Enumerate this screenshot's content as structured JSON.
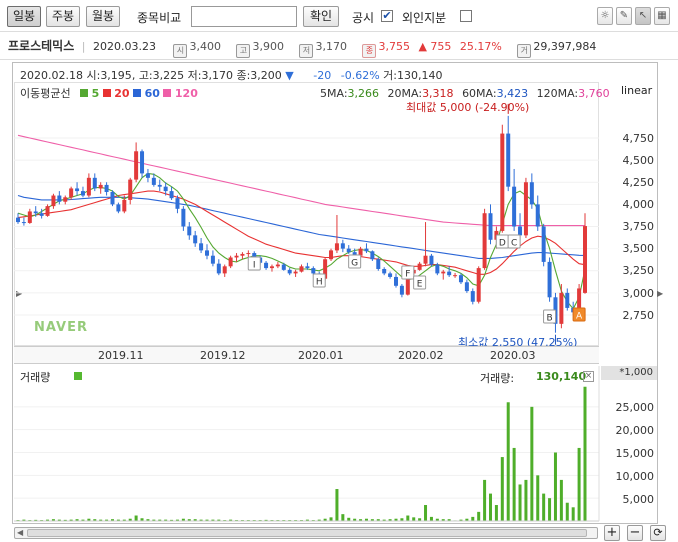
{
  "toolbar": {
    "tabs": [
      "일봉",
      "주봉",
      "월봉"
    ],
    "selected_tab": 0,
    "compare_label": "종목비교",
    "compare_placeholder": "",
    "confirm_label": "확인",
    "disclosure_label": "공시",
    "disclosure_checked": true,
    "foreign_label": "외인지분",
    "foreign_checked": false
  },
  "stock": {
    "name": "프로스테믹스",
    "date": "2020.03.23",
    "start_label": "시",
    "start": "3,400",
    "high_label": "고",
    "high": "3,900",
    "low_label": "저",
    "low": "3,170",
    "close_label": "종",
    "close": "3,755",
    "change": "▲ 755",
    "rate": "25.17%",
    "volume_label": "거",
    "volume": "29,397,984"
  },
  "hover": {
    "date": "2020.02.18",
    "open_label": "시:",
    "open": "3,195",
    "high_label": "고:",
    "high": "3,225",
    "low_label": "저:",
    "low": "3,170",
    "close_label": "종:",
    "close": "3,200",
    "dir": "▼",
    "change": "-20",
    "rate": "-0.62%",
    "vol_label": "거:",
    "vol": "130,140"
  },
  "scale_mode": "linear",
  "ma_legend": {
    "title": "이동평균선",
    "items": [
      {
        "n": "5",
        "color": "#55a832"
      },
      {
        "n": "20",
        "color": "#e83232"
      },
      {
        "n": "60",
        "color": "#2b66d6"
      },
      {
        "n": "120",
        "color": "#ef5fa8"
      }
    ]
  },
  "ma_values": [
    {
      "label": "5MA:",
      "value": "3,266",
      "color": "#3a8a1c"
    },
    {
      "label": "20MA:",
      "value": "3,318",
      "color": "#c81e1e"
    },
    {
      "label": "60MA:",
      "value": "3,423",
      "color": "#1e55c0"
    },
    {
      "label": "120MA:",
      "value": "3,760",
      "color": "#e0409a"
    }
  ],
  "max_label": "최대값 5,000 (-24.90%)",
  "min_label": "최소값 2,550 (47.25%)",
  "brand": "NAVER",
  "x_ticks": [
    "2019.11",
    "2019.12",
    "2020.01",
    "2020.02",
    "2020.03"
  ],
  "y_ticks": [
    "4,750",
    "4,500",
    "4,250",
    "4,000",
    "3,750",
    "3,500",
    "3,250",
    "3,000",
    "2,750"
  ],
  "markers": [
    "I",
    "H",
    "G",
    "F",
    "E",
    "D",
    "C",
    "B",
    "A"
  ],
  "volume": {
    "title": "거래량",
    "legend_color": "#55b830",
    "value_label": "거래량:",
    "value": "130,140",
    "unit": "*1,000",
    "y_ticks": [
      "25,000",
      "20,000",
      "15,000",
      "10,000",
      "5,000"
    ]
  },
  "colors": {
    "up": "#e23a3a",
    "down": "#2f6fd8",
    "vol": "#4fae2a"
  },
  "chart_data": {
    "type": "candlestick",
    "x_range": [
      "2019-10-17",
      "2020-03-23"
    ],
    "ylim": [
      2550,
      5050
    ],
    "candles_ohlc": [
      [
        3850,
        3900,
        3780,
        3800
      ],
      [
        3800,
        3850,
        3760,
        3790
      ],
      [
        3790,
        3950,
        3780,
        3920
      ],
      [
        3920,
        3980,
        3860,
        3900
      ],
      [
        3900,
        3950,
        3840,
        3870
      ],
      [
        3870,
        4000,
        3860,
        3980
      ],
      [
        3980,
        4120,
        3950,
        4100
      ],
      [
        4100,
        4150,
        4000,
        4030
      ],
      [
        4030,
        4100,
        4000,
        4080
      ],
      [
        4080,
        4200,
        4050,
        4180
      ],
      [
        4180,
        4250,
        4100,
        4150
      ],
      [
        4150,
        4200,
        4080,
        4100
      ],
      [
        4100,
        4350,
        4080,
        4300
      ],
      [
        4300,
        4350,
        4150,
        4180
      ],
      [
        4180,
        4250,
        4120,
        4220
      ],
      [
        4220,
        4250,
        4100,
        4140
      ],
      [
        4140,
        4160,
        3980,
        4000
      ],
      [
        4000,
        4020,
        3900,
        3920
      ],
      [
        3920,
        4100,
        3900,
        4050
      ],
      [
        4050,
        4300,
        4000,
        4280
      ],
      [
        4280,
        4700,
        4250,
        4600
      ],
      [
        4600,
        4620,
        4300,
        4350
      ],
      [
        4350,
        4400,
        4250,
        4300
      ],
      [
        4300,
        4350,
        4200,
        4220
      ],
      [
        4220,
        4280,
        4150,
        4200
      ],
      [
        4200,
        4250,
        4100,
        4150
      ],
      [
        4150,
        4200,
        4050,
        4070
      ],
      [
        4070,
        4100,
        3900,
        3950
      ],
      [
        3950,
        3980,
        3700,
        3750
      ],
      [
        3750,
        3800,
        3600,
        3650
      ],
      [
        3650,
        3700,
        3520,
        3560
      ],
      [
        3560,
        3620,
        3450,
        3480
      ],
      [
        3480,
        3550,
        3380,
        3420
      ],
      [
        3420,
        3480,
        3300,
        3330
      ],
      [
        3330,
        3380,
        3200,
        3220
      ],
      [
        3220,
        3320,
        3180,
        3300
      ],
      [
        3300,
        3420,
        3280,
        3400
      ],
      [
        3400,
        3450,
        3350,
        3420
      ],
      [
        3420,
        3460,
        3380,
        3440
      ],
      [
        3440,
        3480,
        3400,
        3450
      ],
      [
        3450,
        3470,
        3380,
        3400
      ],
      [
        3400,
        3420,
        3320,
        3340
      ],
      [
        3340,
        3360,
        3260,
        3280
      ],
      [
        3280,
        3320,
        3240,
        3300
      ],
      [
        3300,
        3350,
        3280,
        3320
      ],
      [
        3320,
        3340,
        3250,
        3260
      ],
      [
        3260,
        3280,
        3200,
        3220
      ],
      [
        3220,
        3260,
        3180,
        3240
      ],
      [
        3240,
        3320,
        3230,
        3300
      ],
      [
        3300,
        3340,
        3260,
        3280
      ],
      [
        3280,
        3300,
        3200,
        3220
      ],
      [
        3220,
        3240,
        3140,
        3160
      ],
      [
        3160,
        3400,
        3140,
        3380
      ],
      [
        3380,
        3500,
        3360,
        3480
      ],
      [
        3480,
        3880,
        3450,
        3560
      ],
      [
        3560,
        3600,
        3460,
        3500
      ],
      [
        3500,
        3540,
        3440,
        3460
      ],
      [
        3460,
        3500,
        3400,
        3420
      ],
      [
        3420,
        3520,
        3400,
        3500
      ],
      [
        3500,
        3560,
        3450,
        3470
      ],
      [
        3470,
        3480,
        3360,
        3380
      ],
      [
        3380,
        3400,
        3250,
        3270
      ],
      [
        3270,
        3290,
        3200,
        3220
      ],
      [
        3220,
        3240,
        3160,
        3180
      ],
      [
        3180,
        3220,
        3060,
        3080
      ],
      [
        3080,
        3100,
        2950,
        2980
      ],
      [
        2980,
        3250,
        2970,
        3220
      ],
      [
        3220,
        3300,
        3200,
        3260
      ],
      [
        3260,
        3350,
        3250,
        3330
      ],
      [
        3330,
        3800,
        3300,
        3420
      ],
      [
        3420,
        3440,
        3300,
        3320
      ],
      [
        3320,
        3340,
        3200,
        3220
      ],
      [
        3220,
        3260,
        3150,
        3240
      ],
      [
        3240,
        3300,
        3180,
        3200
      ],
      [
        3200,
        3225,
        3170,
        3200
      ],
      [
        3200,
        3220,
        3100,
        3120
      ],
      [
        3120,
        3150,
        3000,
        3020
      ],
      [
        3020,
        3050,
        2870,
        2900
      ],
      [
        2900,
        3300,
        2880,
        3280
      ],
      [
        3280,
        3950,
        3260,
        3900
      ],
      [
        3900,
        4000,
        3550,
        3600
      ],
      [
        3600,
        3750,
        3500,
        3700
      ],
      [
        3700,
        4900,
        3680,
        4800
      ],
      [
        4800,
        5000,
        4150,
        4200
      ],
      [
        4200,
        4400,
        3700,
        3750
      ],
      [
        3750,
        3900,
        3600,
        3650
      ],
      [
        3650,
        4300,
        3620,
        4250
      ],
      [
        4250,
        4350,
        3950,
        4000
      ],
      [
        4000,
        4100,
        3700,
        3750
      ],
      [
        3750,
        3780,
        3300,
        3350
      ],
      [
        3350,
        3400,
        2900,
        2950
      ],
      [
        2950,
        3000,
        2550,
        2650
      ],
      [
        2650,
        3100,
        2600,
        3000
      ],
      [
        3000,
        3050,
        2800,
        2830
      ],
      [
        2830,
        2900,
        2750,
        2780
      ],
      [
        2780,
        3100,
        2760,
        3050
      ],
      [
        3000,
        3900,
        2990,
        3755
      ]
    ],
    "ma5": [
      3900,
      3880,
      3860,
      3880,
      3920,
      3960,
      4000,
      4040,
      4060,
      4080,
      4100,
      4120,
      4160,
      4190,
      4190,
      4180,
      4150,
      4090,
      4060,
      4100,
      4200,
      4300,
      4350,
      4340,
      4300,
      4240,
      4200,
      4150,
      4060,
      3950,
      3850,
      3740,
      3620,
      3520,
      3450,
      3400,
      3360,
      3350,
      3380,
      3400,
      3420,
      3420,
      3410,
      3390,
      3360,
      3330,
      3290,
      3270,
      3270,
      3270,
      3260,
      3250,
      3280,
      3320,
      3380,
      3420,
      3460,
      3480,
      3490,
      3480,
      3450,
      3410,
      3360,
      3300,
      3240,
      3180,
      3150,
      3160,
      3200,
      3250,
      3300,
      3320,
      3300,
      3270,
      3250,
      3220,
      3170,
      3100,
      3080,
      3200,
      3400,
      3550,
      3780,
      4000,
      4120,
      4150,
      4100,
      4050,
      3950,
      3700,
      3500,
      3250,
      3020,
      2900,
      2820,
      2950,
      3266
    ],
    "ma20": [
      3850,
      3860,
      3870,
      3880,
      3890,
      3900,
      3910,
      3920,
      3930,
      3940,
      3960,
      3980,
      4000,
      4020,
      4040,
      4060,
      4080,
      4100,
      4110,
      4120,
      4130,
      4140,
      4150,
      4150,
      4140,
      4120,
      4100,
      4080,
      4060,
      4030,
      4000,
      3960,
      3920,
      3880,
      3840,
      3800,
      3760,
      3720,
      3680,
      3640,
      3610,
      3580,
      3550,
      3530,
      3510,
      3490,
      3470,
      3450,
      3440,
      3430,
      3420,
      3410,
      3400,
      3400,
      3410,
      3420,
      3420,
      3420,
      3410,
      3400,
      3390,
      3380,
      3370,
      3360,
      3350,
      3330,
      3310,
      3300,
      3300,
      3310,
      3320,
      3320,
      3310,
      3300,
      3290,
      3270,
      3250,
      3230,
      3210,
      3210,
      3230,
      3270,
      3330,
      3400,
      3470,
      3530,
      3580,
      3620,
      3640,
      3630,
      3600,
      3560,
      3500,
      3440,
      3380,
      3330,
      3318
    ],
    "ma60": [
      4100,
      4080,
      4070,
      4060,
      4050,
      4050,
      4050,
      4050,
      4050,
      4055,
      4060,
      4065,
      4070,
      4075,
      4080,
      4080,
      4080,
      4080,
      4080,
      4075,
      4070,
      4065,
      4060,
      4050,
      4040,
      4030,
      4020,
      4010,
      4000,
      3990,
      3975,
      3960,
      3945,
      3930,
      3915,
      3900,
      3885,
      3870,
      3855,
      3840,
      3825,
      3810,
      3795,
      3780,
      3765,
      3750,
      3735,
      3720,
      3705,
      3690,
      3675,
      3660,
      3650,
      3640,
      3630,
      3620,
      3610,
      3600,
      3590,
      3580,
      3570,
      3560,
      3550,
      3540,
      3530,
      3520,
      3510,
      3500,
      3490,
      3480,
      3470,
      3460,
      3450,
      3440,
      3430,
      3420,
      3410,
      3400,
      3390,
      3390,
      3390,
      3395,
      3400,
      3410,
      3420,
      3430,
      3440,
      3450,
      3455,
      3455,
      3450,
      3445,
      3440,
      3435,
      3430,
      3425,
      3423
    ],
    "ma120": [
      4780,
      4765,
      4750,
      4735,
      4720,
      4705,
      4690,
      4675,
      4660,
      4645,
      4630,
      4615,
      4600,
      4585,
      4570,
      4555,
      4540,
      4525,
      4510,
      4495,
      4480,
      4465,
      4450,
      4435,
      4420,
      4405,
      4390,
      4375,
      4360,
      4345,
      4330,
      4315,
      4300,
      4285,
      4270,
      4255,
      4240,
      4225,
      4210,
      4195,
      4180,
      4165,
      4150,
      4135,
      4120,
      4105,
      4090,
      4075,
      4060,
      4045,
      4030,
      4015,
      4000,
      3990,
      3980,
      3970,
      3960,
      3950,
      3940,
      3930,
      3920,
      3910,
      3900,
      3890,
      3880,
      3870,
      3860,
      3850,
      3840,
      3830,
      3820,
      3810,
      3800,
      3795,
      3790,
      3785,
      3780,
      3775,
      3770,
      3765,
      3760,
      3760,
      3760,
      3760,
      3760,
      3760,
      3760,
      3760,
      3760,
      3760,
      3760,
      3760,
      3760,
      3760,
      3760,
      3760,
      3760
    ],
    "volume_k": [
      200,
      300,
      200,
      250,
      200,
      300,
      400,
      300,
      250,
      300,
      400,
      300,
      500,
      400,
      300,
      300,
      400,
      300,
      300,
      500,
      1200,
      600,
      400,
      300,
      300,
      300,
      250,
      300,
      500,
      400,
      400,
      300,
      300,
      300,
      300,
      200,
      300,
      200,
      200,
      200,
      200,
      200,
      250,
      200,
      200,
      200,
      200,
      200,
      200,
      300,
      200,
      300,
      500,
      800,
      7000,
      1500,
      700,
      500,
      400,
      500,
      400,
      400,
      300,
      400,
      500,
      600,
      1200,
      800,
      600,
      3500,
      900,
      500,
      400,
      400,
      130,
      300,
      500,
      900,
      2000,
      9000,
      6000,
      3500,
      14000,
      26000,
      16000,
      8000,
      9000,
      25000,
      10000,
      6000,
      5000,
      15000,
      9000,
      4000,
      3000,
      16000,
      29400
    ],
    "volume_ylim": [
      0,
      30000
    ]
  }
}
